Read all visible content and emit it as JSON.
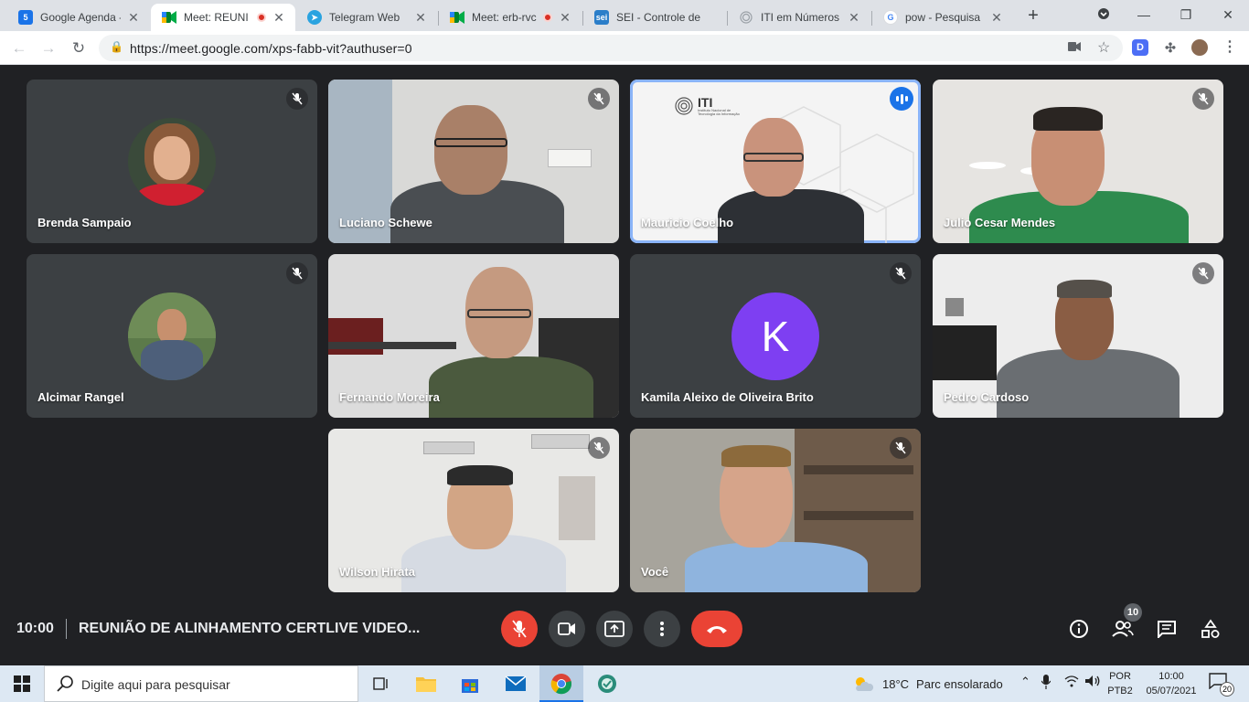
{
  "browser": {
    "tabs": [
      {
        "title": "Google Agenda -",
        "favicon": "calendar-icon",
        "favicon_color": "#1a73e8",
        "favicon_text": "5",
        "active": false,
        "recording": false
      },
      {
        "title": "Meet: REUNI",
        "favicon": "meet-icon",
        "favicon_color": "#00832d",
        "favicon_text": "",
        "active": true,
        "recording": true
      },
      {
        "title": "Telegram Web",
        "favicon": "telegram-icon",
        "favicon_color": "#2aa3e0",
        "favicon_text": "",
        "active": false,
        "recording": false
      },
      {
        "title": "Meet: erb-rvc",
        "favicon": "meet-icon",
        "favicon_color": "#00832d",
        "favicon_text": "",
        "active": false,
        "recording": true
      },
      {
        "title": "SEI - Controle de",
        "favicon": "sei-icon",
        "favicon_color": "#2b7ec9",
        "favicon_text": "sei",
        "active": false,
        "recording": false
      },
      {
        "title": "ITI em Números",
        "favicon": "iti-icon",
        "favicon_color": "#9aa0a6",
        "favicon_text": "",
        "active": false,
        "recording": false
      },
      {
        "title": "pow - Pesquisa G",
        "favicon": "google-icon",
        "favicon_color": "#ffffff",
        "favicon_text": "G",
        "active": false,
        "recording": false
      }
    ],
    "url": "https://meet.google.com/xps-fabb-vit?authuser=0",
    "extension_letter": "D"
  },
  "participants": [
    {
      "name": "Brenda Sampaio",
      "type": "photo",
      "muted": true
    },
    {
      "name": "Luciano Schewe",
      "type": "video",
      "muted": true
    },
    {
      "name": "Mauricio Coelho",
      "type": "video",
      "muted": false,
      "speaking": true
    },
    {
      "name": "Julio Cesar Mendes",
      "type": "video",
      "muted": true
    },
    {
      "name": "Alcimar Rangel",
      "type": "photo",
      "muted": true
    },
    {
      "name": "Fernando Moreira",
      "type": "video",
      "muted": false
    },
    {
      "name": "Kamila Aleixo de Oliveira Brito",
      "type": "letter",
      "letter": "K",
      "muted": true
    },
    {
      "name": "Pedro Cardoso",
      "type": "video",
      "muted": true
    },
    {
      "name": "Wilson Hirata",
      "type": "video",
      "muted": true
    },
    {
      "name": "Você",
      "type": "video",
      "muted": true
    }
  ],
  "iti_logo": {
    "text": "ITI",
    "subtitle": "Instituto Nacional de Tecnologia da Informação"
  },
  "meeting": {
    "time": "10:00",
    "title": "REUNIÃO DE ALINHAMENTO CERTLIVE VIDEO...",
    "people_count": "10"
  },
  "colors": {
    "meet_bg": "#202124",
    "tile_bg": "#3c4043",
    "danger_red": "#ea4335",
    "speaking_blue": "#1a73e8",
    "avatar_purple": "#7e3ff2"
  },
  "taskbar": {
    "search_placeholder": "Digite aqui para pesquisar",
    "weather_temp": "18°C",
    "weather_text": "Parc ensolarado",
    "lang_line1": "POR",
    "lang_line2": "PTB2",
    "clock_time": "10:00",
    "clock_date": "05/07/2021",
    "notification_count": "20"
  }
}
